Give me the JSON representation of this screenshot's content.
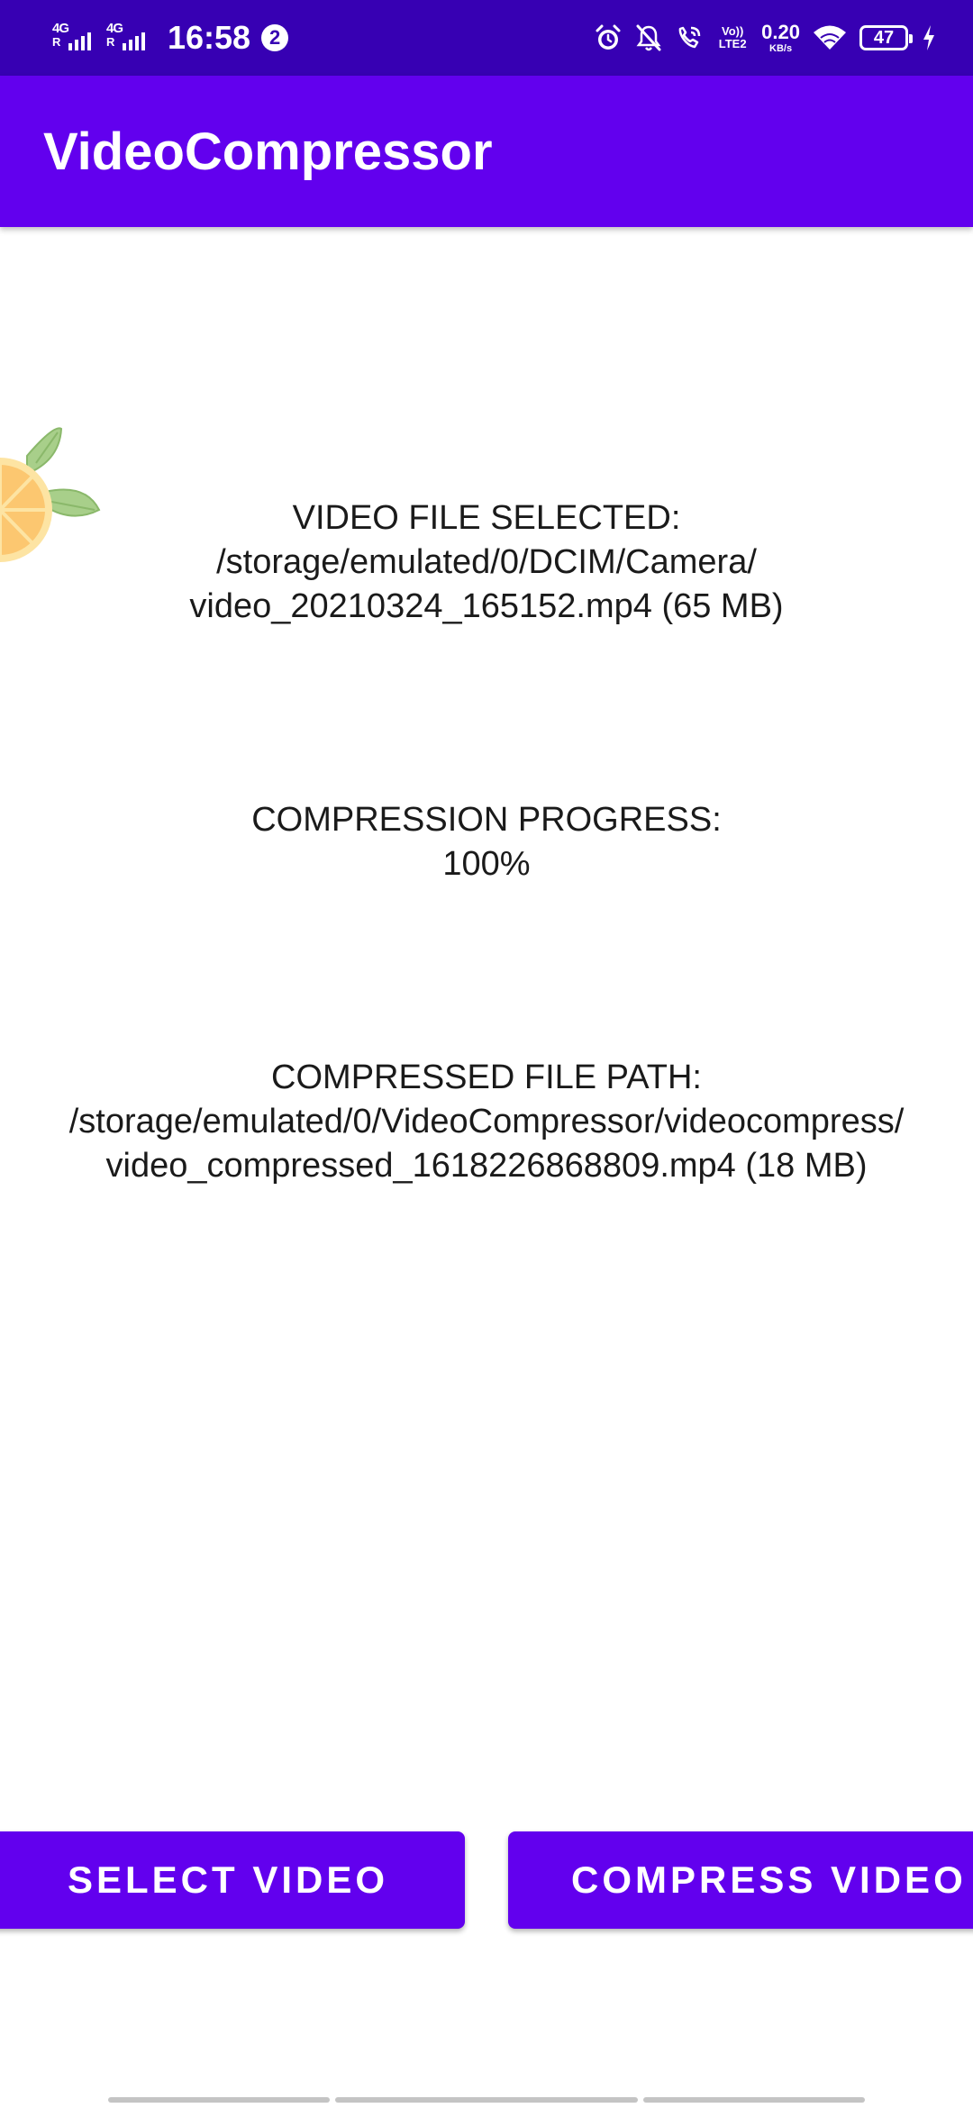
{
  "status_bar": {
    "sim1_label": "4G",
    "sim2_label": "4G",
    "time": "16:58",
    "notification_count": "2",
    "volte_label": "Vo)) LTE2",
    "net_speed_value": "0.20",
    "net_speed_unit": "KB/s",
    "battery_level": "47"
  },
  "app_bar": {
    "title": "VideoCompressor"
  },
  "selected_file": {
    "heading": "VIDEO FILE SELECTED:",
    "path_line1": "/storage/emulated/0/DCIM/Camera/",
    "path_line2": "video_20210324_165152.mp4 (65 MB)"
  },
  "progress": {
    "heading": "COMPRESSION PROGRESS:",
    "value": "100%"
  },
  "compressed_file": {
    "heading": "COMPRESSED FILE PATH:",
    "path_line1": "/storage/emulated/0/VideoCompressor/videocompress/",
    "path_line2": "video_compressed_1618226868809.mp4 (18 MB)"
  },
  "buttons": {
    "select_label": "SELECT VIDEO",
    "compress_label": "COMPRESS VIDEO"
  },
  "colors": {
    "status_bar": "#3700b3",
    "app_bar": "#6200ee",
    "button": "#6200ee"
  },
  "icons": [
    "signal-icon",
    "notification-badge-icon",
    "alarm-icon",
    "bell-off-icon",
    "wifi-call-icon",
    "wifi-icon",
    "battery-icon",
    "charging-icon",
    "fruit-decoration-icon"
  ]
}
